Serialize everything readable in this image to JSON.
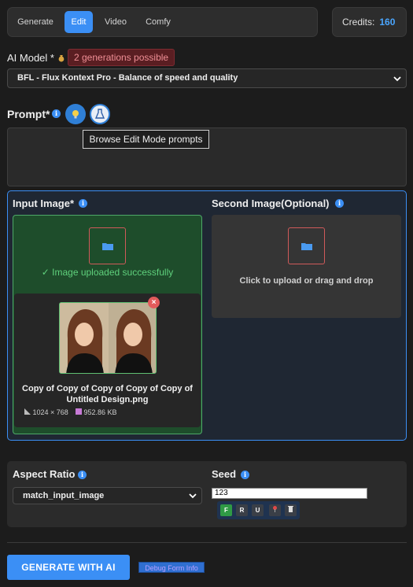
{
  "tabs": [
    {
      "label": "Generate"
    },
    {
      "label": "Edit"
    },
    {
      "label": "Video"
    },
    {
      "label": "Comfy"
    }
  ],
  "credits": {
    "label": "Credits:",
    "value": "160"
  },
  "ai_model": {
    "label": "AI Model *",
    "badge": "2 generations possible",
    "selected": "BFL - Flux Kontext Pro - Balance of speed and quality"
  },
  "prompt": {
    "label": "Prompt*",
    "tooltip": "Browse Edit Mode prompts",
    "value": ""
  },
  "input_image": {
    "label": "Input Image*",
    "status": "✓ Image uploaded successfully",
    "file_name": "Copy of Copy of Copy of Copy of Copy of Untitled Design.png",
    "dimensions": "1024 × 768",
    "size": "952.86 KB"
  },
  "second_image": {
    "label": "Second Image(Optional)",
    "placeholder": "Click to upload or drag and drop"
  },
  "aspect_ratio": {
    "label": "Aspect Ratio",
    "selected": "match_input_image"
  },
  "seed": {
    "label": "Seed",
    "value": "123",
    "buttons": [
      "F",
      "R",
      "U"
    ]
  },
  "actions": {
    "generate": "GENERATE WITH AI",
    "debug": "Debug Form Info"
  },
  "colors": {
    "accent": "#3b8ff5",
    "success": "#4ea868",
    "danger": "#e25b5b"
  }
}
